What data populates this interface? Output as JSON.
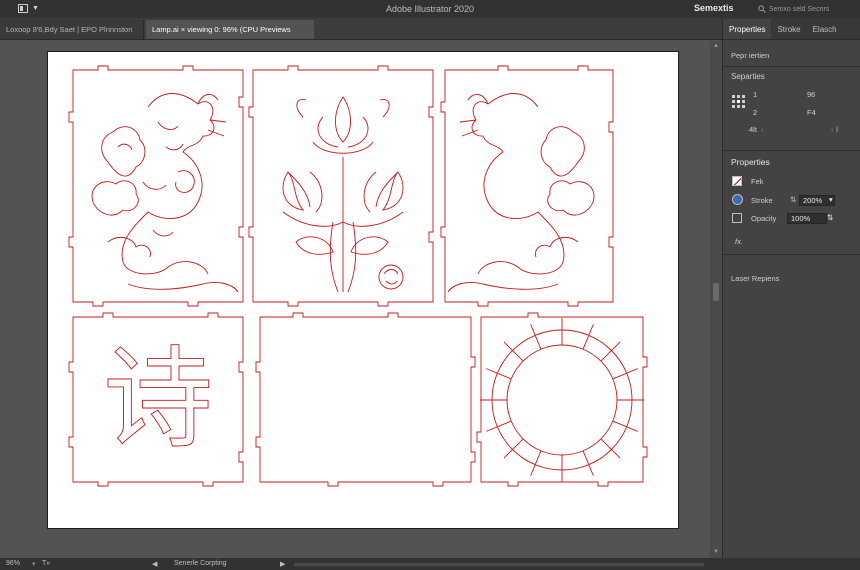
{
  "app": {
    "title": "Adobe Illustrator 2020",
    "workspace": "Semextis",
    "search_placeholder": "Semxo seld Secnrs"
  },
  "tabs": [
    {
      "label": "Loxoop 8'6,Bdy Saet | EPO Plnnnston",
      "close": "×"
    },
    {
      "label": "Lamp.ai  ×  viewing 0: 96% (CPU Previews",
      "close": "×"
    }
  ],
  "panel": {
    "tabs": [
      "Properties",
      "Stroke",
      "Elasch"
    ],
    "doc_label": "Pepr iertien",
    "section1": "Separties",
    "transform": {
      "r1_left": "1",
      "r1_right": "96",
      "r2_left": "2",
      "r2_right": "F4",
      "r3_left": "4lt"
    },
    "section2": "Properties",
    "fill_label": "Fek",
    "stroke_label": "Stroke",
    "stroke_value": "200%",
    "opacity_label": "Opacity",
    "opacity_value": "100%",
    "fx_label": "fx.",
    "laser_label": "Laser Repiens",
    "colors": {
      "stroke": "#d00000",
      "accent": "#3b6bb5"
    }
  },
  "status": {
    "zoom": "96%",
    "page_label": "T»",
    "info": "Senerle Corpting",
    "nav_prev": "◀",
    "nav_next": "▶"
  },
  "artwork": {
    "glyph": "诗",
    "line_color": "#c41a1a"
  },
  "icons": {
    "home": "home-icon",
    "search": "search-icon",
    "transform": "transform-grid-icon",
    "fill": "fill-swatch-icon",
    "stroke": "stroke-swatch-icon",
    "opacity": "opacity-icon",
    "fx": "fx-icon"
  }
}
